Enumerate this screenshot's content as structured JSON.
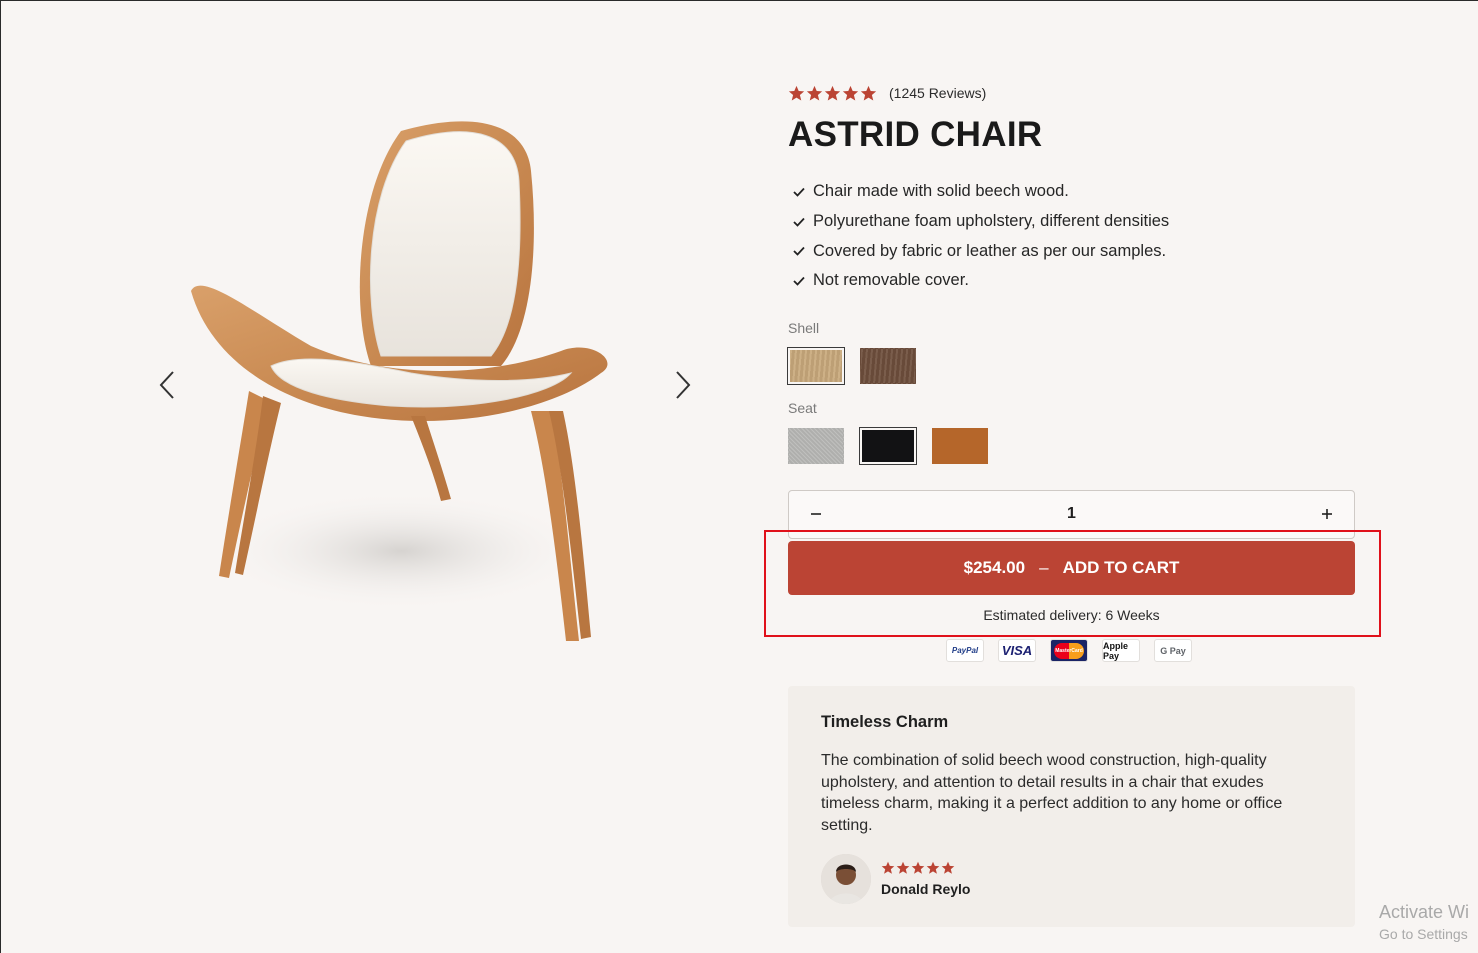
{
  "product": {
    "rating": 5,
    "reviews_text": "(1245 Reviews)",
    "title": "ASTRID CHAIR",
    "features": [
      "Chair made with solid beech wood.",
      "Polyurethane foam upholstery, different densities",
      "Covered by fabric or leather as per our samples.",
      "Not removable cover."
    ]
  },
  "options": {
    "shell_label": "Shell",
    "seat_label": "Seat",
    "shell_swatches": [
      {
        "name": "light-wood",
        "color": "#c9a97c",
        "selected": true
      },
      {
        "name": "dark-wood",
        "color": "#6f4f3d",
        "selected": false
      }
    ],
    "seat_swatches": [
      {
        "name": "grey-fabric",
        "color": "#b8b8b6",
        "selected": false
      },
      {
        "name": "black-leather",
        "color": "#121214",
        "selected": true
      },
      {
        "name": "cognac-leather",
        "color": "#b5662a",
        "selected": false
      }
    ]
  },
  "quantity": {
    "value": "1",
    "minus_icon": "minus-icon",
    "plus_icon": "plus-icon"
  },
  "cart": {
    "price": "$254.00",
    "separator": "–",
    "label": "ADD TO CART",
    "delivery": "Estimated delivery: 6 Weeks"
  },
  "payments": [
    "PayPal",
    "VISA",
    "MasterCard",
    "Apple Pay",
    "G Pay"
  ],
  "testimonial": {
    "title": "Timeless Charm",
    "body": "The combination of solid beech wood construction, high-quality upholstery, and attention to detail results in a chair that exudes timeless charm, making it a perfect addition to any home or office setting.",
    "rating": 5,
    "name": "Donald Reylo"
  },
  "gallery": {
    "prev_icon": "chevron-left-icon",
    "next_icon": "chevron-right-icon"
  },
  "watermark": {
    "line1": "Activate Wi",
    "line2": "Go to Settings"
  },
  "colors": {
    "accent": "#bb4434",
    "star": "#bb4434",
    "background": "#f8f5f3",
    "highlight": "#e0101a"
  }
}
